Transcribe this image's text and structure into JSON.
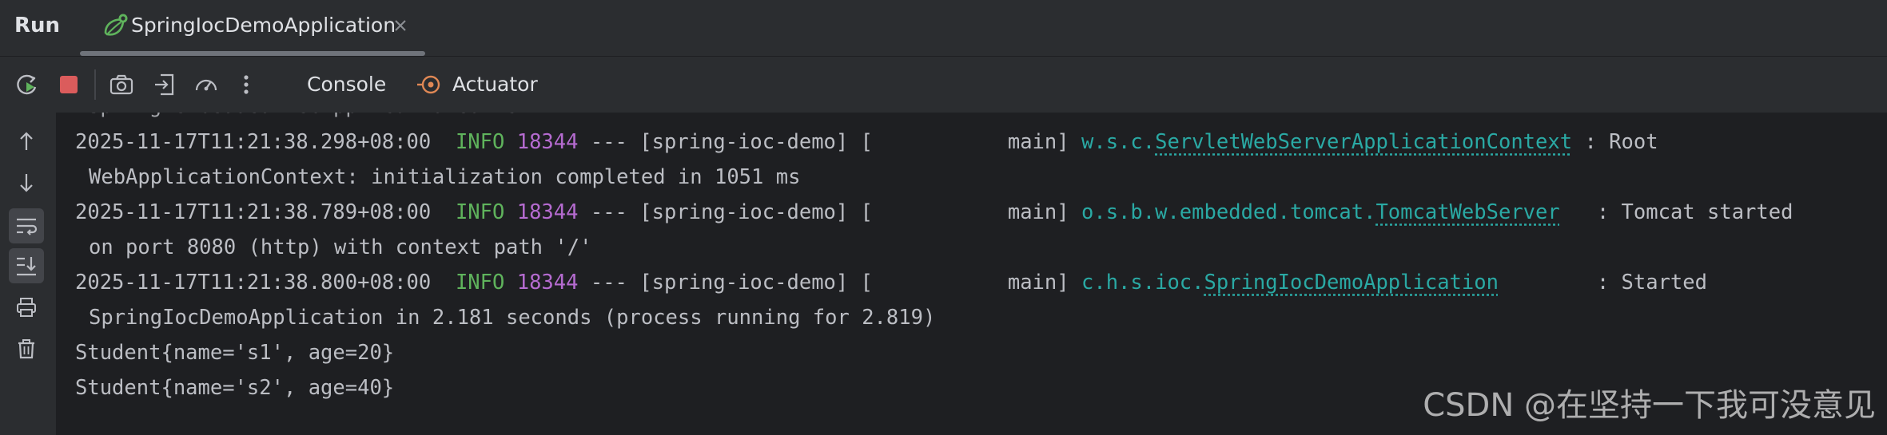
{
  "run_panel": {
    "title": "Run",
    "tab": {
      "title": "SpringIocDemoApplication",
      "icon": "spring-run-icon",
      "close_icon": "close-icon"
    }
  },
  "toolbar": {
    "buttons": [
      {
        "name": "rerun-icon"
      },
      {
        "name": "stop-icon"
      },
      {
        "name": "screenshot-camera-icon"
      },
      {
        "name": "exit-icon"
      },
      {
        "name": "profiler-gauge-icon"
      },
      {
        "name": "more-options-icon"
      }
    ],
    "tabs": {
      "console": "Console",
      "actuator": "Actuator"
    }
  },
  "gutter": {
    "buttons": [
      {
        "name": "up-arrow-icon"
      },
      {
        "name": "down-arrow-icon"
      },
      {
        "name": "soft-wrap-icon"
      },
      {
        "name": "scroll-to-end-icon"
      },
      {
        "name": "print-icon"
      },
      {
        "name": "trash-icon"
      }
    ]
  },
  "console": {
    "partial_top": "Spring embedded WebApplicationContext",
    "logs": [
      {
        "timestamp": "2025-11-17T11:21:38.298+08:00",
        "level": "INFO",
        "pid": "18344",
        "sep": "---",
        "app": "[spring-ioc-demo]",
        "thread": "[           main]",
        "logger_pkg": "w.s.c.",
        "logger_cls": "ServletWebServerApplicationContext",
        "logger_pad": "",
        "msg_head": ": Root",
        "msg_tail": "WebApplicationContext: initialization completed in 1051 ms"
      },
      {
        "timestamp": "2025-11-17T11:21:38.789+08:00",
        "level": "INFO",
        "pid": "18344",
        "sep": "---",
        "app": "[spring-ioc-demo]",
        "thread": "[           main]",
        "logger_pkg": "o.s.b.w.embedded.tomcat.",
        "logger_cls": "TomcatWebServer",
        "logger_pad": "  ",
        "msg_head": ": Tomcat started",
        "msg_tail": "on port 8080 (http) with context path '/'"
      },
      {
        "timestamp": "2025-11-17T11:21:38.800+08:00",
        "level": "INFO",
        "pid": "18344",
        "sep": "---",
        "app": "[spring-ioc-demo]",
        "thread": "[           main]",
        "logger_pkg": "c.h.s.ioc.",
        "logger_cls": "SpringIocDemoApplication",
        "logger_pad": "       ",
        "msg_head": ": Started",
        "msg_tail": "SpringIocDemoApplication in 2.181 seconds (process running for 2.819)"
      }
    ],
    "plain_lines": [
      "Student{name='s1', age=20}",
      "Student{name='s2', age=40}"
    ]
  },
  "watermark": "CSDN @在坚持一下我可没意见",
  "colors": {
    "background": "#1e1f22",
    "panel": "#2b2d30",
    "text": "#bcbec4",
    "info": "#5fb35c",
    "pid": "#b56bd0",
    "logger": "#2aa9a4",
    "stop": "#db5c5c",
    "rerun": "#5fb35c"
  }
}
